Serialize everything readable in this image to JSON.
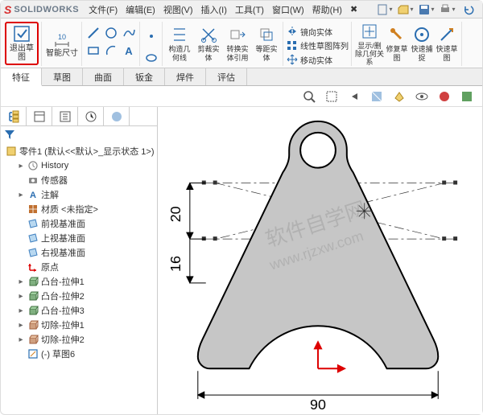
{
  "app": {
    "logo_letter": "S",
    "logo_text": "SOLIDWORKS"
  },
  "menus": [
    {
      "label": "文件(F)"
    },
    {
      "label": "编辑(E)"
    },
    {
      "label": "视图(V)"
    },
    {
      "label": "插入(I)"
    },
    {
      "label": "工具(T)"
    },
    {
      "label": "窗口(W)"
    },
    {
      "label": "帮助(H)"
    },
    {
      "label": "✖"
    }
  ],
  "qat": [
    {
      "name": "new-icon"
    },
    {
      "name": "open-icon"
    },
    {
      "name": "save-icon"
    },
    {
      "name": "print-icon"
    },
    {
      "name": "undo-icon"
    }
  ],
  "ribbon_big": [
    {
      "name": "exit-sketch",
      "label": "退出草图",
      "highlighted": true
    },
    {
      "name": "smart-dimension",
      "label": "智能尺寸"
    }
  ],
  "ribbon_mid": [
    {
      "name": "convert-entities",
      "label": "构造几何线"
    },
    {
      "name": "trim-entities",
      "label": "剪裁实体"
    },
    {
      "name": "convert-body",
      "label": "转换实体引用"
    },
    {
      "name": "offset-entities",
      "label": "等距实体"
    },
    {
      "name": "mirror",
      "label": "镜向实体"
    },
    {
      "name": "linear-pattern",
      "label": "线性草图阵列"
    },
    {
      "name": "move",
      "label": "移动实体"
    }
  ],
  "ribbon_right": [
    {
      "name": "show-hide",
      "label": "显示/删除几何关系"
    },
    {
      "name": "repair",
      "label": "修复草图"
    },
    {
      "name": "quick-snap",
      "label": "快速捕捉"
    },
    {
      "name": "rapid-sketch",
      "label": "快速草图"
    }
  ],
  "command_tabs": [
    {
      "label": "特征",
      "active": true
    },
    {
      "label": "草图"
    },
    {
      "label": "曲面"
    },
    {
      "label": "钣金"
    },
    {
      "label": "焊件"
    },
    {
      "label": "评估"
    }
  ],
  "heads_up": [
    {
      "name": "zoom-fit-icon"
    },
    {
      "name": "zoom-area-icon"
    },
    {
      "name": "prev-view-icon"
    },
    {
      "name": "section-icon"
    },
    {
      "name": "display-style-icon"
    },
    {
      "name": "hide-show-icon"
    },
    {
      "name": "edit-appearance-icon"
    },
    {
      "name": "apply-scene-icon"
    }
  ],
  "fm_tabs": [
    {
      "name": "feature-tree-icon"
    },
    {
      "name": "property-manager-icon"
    },
    {
      "name": "config-manager-icon"
    },
    {
      "name": "dimxpert-icon"
    },
    {
      "name": "display-manager-icon"
    }
  ],
  "tree_root": "零件1 (默认<<默认>_显示状态 1>)",
  "tree_items": [
    {
      "icon": "history-icon",
      "label": "History",
      "exp": "▸"
    },
    {
      "icon": "sensors-icon",
      "label": "传感器",
      "exp": " "
    },
    {
      "icon": "annotations-icon",
      "label": "注解",
      "exp": "▸"
    },
    {
      "icon": "material-icon",
      "label": "材质 <未指定>",
      "exp": " "
    },
    {
      "icon": "plane-icon",
      "label": "前视基准面",
      "exp": " "
    },
    {
      "icon": "plane-icon",
      "label": "上视基准面",
      "exp": " "
    },
    {
      "icon": "plane-icon",
      "label": "右视基准面",
      "exp": " "
    },
    {
      "icon": "origin-icon",
      "label": "原点",
      "exp": " "
    },
    {
      "icon": "extrude-icon",
      "label": "凸台-拉伸1",
      "exp": "▸"
    },
    {
      "icon": "extrude-icon",
      "label": "凸台-拉伸2",
      "exp": "▸"
    },
    {
      "icon": "extrude-icon",
      "label": "凸台-拉伸3",
      "exp": "▸"
    },
    {
      "icon": "cut-icon",
      "label": "切除-拉伸1",
      "exp": "▸"
    },
    {
      "icon": "cut-icon",
      "label": "切除-拉伸2",
      "exp": "▸"
    },
    {
      "icon": "sketch-icon",
      "label": "(-) 草图6",
      "exp": " "
    }
  ],
  "dims": {
    "h1": "20",
    "h2": "16",
    "w": "90"
  },
  "watermark": "软件自学网\nwww.rjzxw.com"
}
